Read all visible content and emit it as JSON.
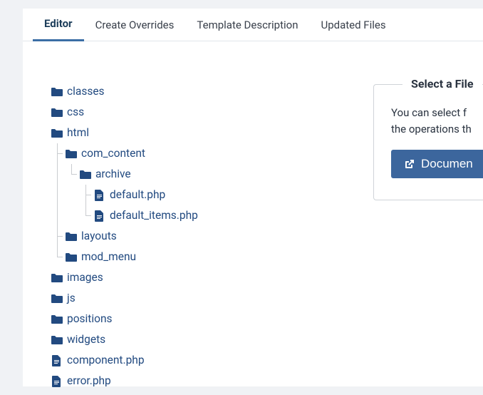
{
  "tabs": [
    {
      "label": "Editor",
      "active": true
    },
    {
      "label": "Create Overrides",
      "active": false
    },
    {
      "label": "Template Description",
      "active": false
    },
    {
      "label": "Updated Files",
      "active": false
    }
  ],
  "tree": {
    "classes": "classes",
    "css": "css",
    "html": "html",
    "com_content": "com_content",
    "archive": "archive",
    "default_php": "default.php",
    "default_items_php": "default_items.php",
    "layouts": "layouts",
    "mod_menu": "mod_menu",
    "images": "images",
    "js": "js",
    "positions": "positions",
    "widgets": "widgets",
    "component_php": "component.php",
    "error_php": "error.php"
  },
  "sidebox": {
    "title": "Select a File",
    "text_line1": "You can select f",
    "text_line2": "the operations th",
    "button_label": "Documen"
  }
}
